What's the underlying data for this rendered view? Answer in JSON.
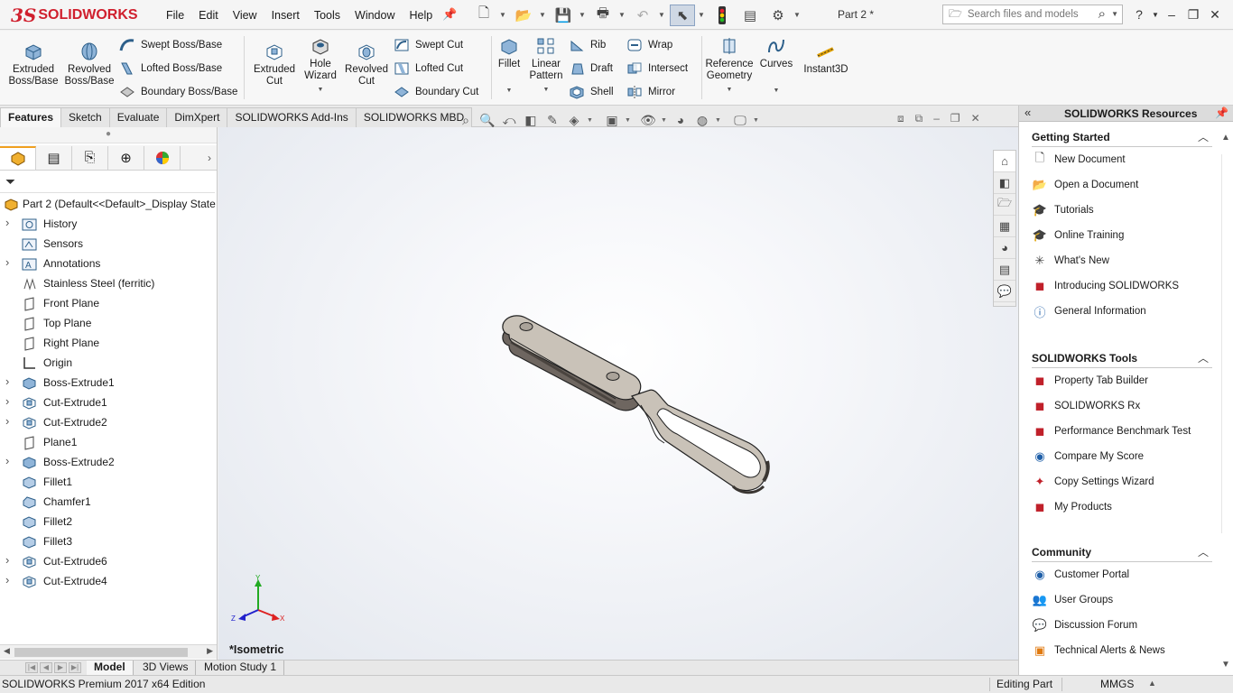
{
  "app": {
    "logo_ds": "3S",
    "logo_text": "SOLIDWORKS",
    "doc_title": "Part 2 *"
  },
  "menu": [
    "File",
    "Edit",
    "View",
    "Insert",
    "Tools",
    "Window",
    "Help"
  ],
  "search": {
    "placeholder": "Search files and models"
  },
  "command_manager": {
    "extruded_boss": "Extruded Boss/Base",
    "revolved_boss": "Revolved Boss/Base",
    "swept_boss": "Swept Boss/Base",
    "lofted_boss": "Lofted Boss/Base",
    "boundary_boss": "Boundary Boss/Base",
    "extruded_cut": "Extruded Cut",
    "hole_wizard": "Hole Wizard",
    "revolved_cut": "Revolved Cut",
    "swept_cut": "Swept Cut",
    "lofted_cut": "Lofted Cut",
    "boundary_cut": "Boundary Cut",
    "fillet": "Fillet",
    "linear_pattern": "Linear Pattern",
    "rib": "Rib",
    "draft": "Draft",
    "shell": "Shell",
    "wrap": "Wrap",
    "intersect": "Intersect",
    "mirror": "Mirror",
    "reference_geometry": "Reference Geometry",
    "curves": "Curves",
    "instant3d": "Instant3D"
  },
  "tabs": [
    "Features",
    "Sketch",
    "Evaluate",
    "DimXpert",
    "SOLIDWORKS Add-Ins",
    "SOLIDWORKS MBD"
  ],
  "active_tab": "Features",
  "feature_tree": {
    "root": "Part 2  (Default<<Default>_Display State",
    "items": [
      {
        "label": "History",
        "expandable": true,
        "icon": "history-icon"
      },
      {
        "label": "Sensors",
        "expandable": false,
        "icon": "sensors-icon"
      },
      {
        "label": "Annotations",
        "expandable": true,
        "icon": "annotations-icon"
      },
      {
        "label": "Stainless Steel (ferritic)",
        "expandable": false,
        "icon": "material-icon"
      },
      {
        "label": "Front Plane",
        "expandable": false,
        "icon": "plane-icon"
      },
      {
        "label": "Top Plane",
        "expandable": false,
        "icon": "plane-icon"
      },
      {
        "label": "Right Plane",
        "expandable": false,
        "icon": "plane-icon"
      },
      {
        "label": "Origin",
        "expandable": false,
        "icon": "origin-icon"
      },
      {
        "label": "Boss-Extrude1",
        "expandable": true,
        "icon": "extrude-icon"
      },
      {
        "label": "Cut-Extrude1",
        "expandable": true,
        "icon": "cut-icon"
      },
      {
        "label": "Cut-Extrude2",
        "expandable": true,
        "icon": "cut-icon"
      },
      {
        "label": "Plane1",
        "expandable": false,
        "icon": "plane-icon"
      },
      {
        "label": "Boss-Extrude2",
        "expandable": true,
        "icon": "extrude-icon"
      },
      {
        "label": "Fillet1",
        "expandable": false,
        "icon": "fillet-icon"
      },
      {
        "label": "Chamfer1",
        "expandable": false,
        "icon": "chamfer-icon"
      },
      {
        "label": "Fillet2",
        "expandable": false,
        "icon": "fillet-icon"
      },
      {
        "label": "Fillet3",
        "expandable": false,
        "icon": "fillet-icon"
      },
      {
        "label": "Cut-Extrude6",
        "expandable": true,
        "icon": "cut-icon"
      },
      {
        "label": "Cut-Extrude4",
        "expandable": true,
        "icon": "cut-icon"
      }
    ]
  },
  "viewport": {
    "view_label": "*Isometric",
    "triad": {
      "x": "X",
      "y": "Y",
      "z": "Z"
    }
  },
  "bottom_tabs": [
    "Model",
    "3D Views",
    "Motion Study 1"
  ],
  "status": {
    "edition": "SOLIDWORKS Premium 2017 x64 Edition",
    "mode": "Editing Part",
    "units": "MMGS"
  },
  "resources": {
    "title": "SOLIDWORKS Resources",
    "sections": [
      {
        "title": "Getting Started",
        "items": [
          {
            "label": "New Document",
            "icon": "new-document-icon"
          },
          {
            "label": "Open a Document",
            "icon": "open-document-icon"
          },
          {
            "label": "Tutorials",
            "icon": "tutorials-icon"
          },
          {
            "label": "Online Training",
            "icon": "online-training-icon"
          },
          {
            "label": "What's New",
            "icon": "whats-new-icon"
          },
          {
            "label": "Introducing SOLIDWORKS",
            "icon": "introducing-icon"
          },
          {
            "label": "General Information",
            "icon": "info-icon"
          }
        ]
      },
      {
        "title": "SOLIDWORKS Tools",
        "items": [
          {
            "label": "Property Tab Builder",
            "icon": "property-tab-builder-icon"
          },
          {
            "label": "SOLIDWORKS Rx",
            "icon": "rx-icon"
          },
          {
            "label": "Performance Benchmark Test",
            "icon": "benchmark-icon"
          },
          {
            "label": "Compare My Score",
            "icon": "compare-score-icon"
          },
          {
            "label": "Copy Settings Wizard",
            "icon": "copy-settings-icon"
          },
          {
            "label": "My Products",
            "icon": "my-products-icon"
          }
        ]
      },
      {
        "title": "Community",
        "items": [
          {
            "label": "Customer Portal",
            "icon": "customer-portal-icon"
          },
          {
            "label": "User Groups",
            "icon": "user-groups-icon"
          },
          {
            "label": "Discussion Forum",
            "icon": "discussion-forum-icon"
          },
          {
            "label": "Technical Alerts & News",
            "icon": "rss-icon"
          }
        ]
      }
    ]
  }
}
